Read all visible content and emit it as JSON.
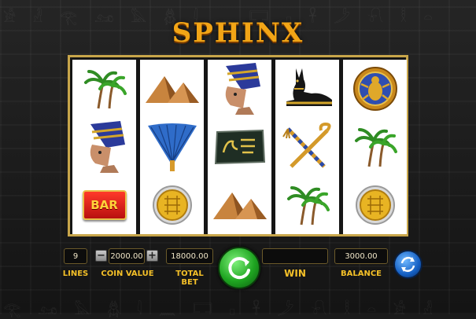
{
  "game": {
    "title": "SPHINX"
  },
  "reels": [
    [
      "palm-trees",
      "nefertiti",
      "bar"
    ],
    [
      "pyramids",
      "fan",
      "gold-coin"
    ],
    [
      "nefertiti",
      "hieroglyph-tablet",
      "pyramids"
    ],
    [
      "anubis",
      "crook-and-flail",
      "palm-trees"
    ],
    [
      "scarab",
      "palm-trees",
      "gold-coin"
    ]
  ],
  "symbols": {
    "bar_text": "BAR"
  },
  "controls": {
    "lines_value": "9",
    "lines_label": "LINES",
    "coin_value": "2000.00",
    "coin_label": "COIN VALUE",
    "minus": "−",
    "plus": "+",
    "total_bet_value": "18000.00",
    "total_bet_label": "TOTAL BET",
    "win_value": "",
    "win_label": "WIN",
    "balance_value": "3000.00",
    "balance_label": "BALANCE"
  },
  "colors": {
    "accent": "#f4c028",
    "frame": "#c8a64a",
    "spin": "#1fa521",
    "autoplay": "#1560c4"
  }
}
